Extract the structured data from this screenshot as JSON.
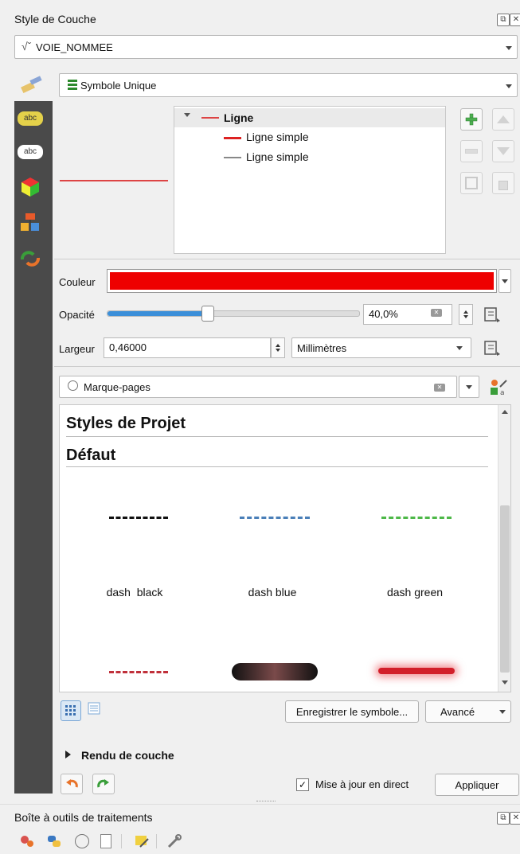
{
  "panel": {
    "title": "Style de Couche",
    "layer_name": "VOIE_NOMMEE",
    "renderer": "Symbole Unique"
  },
  "symbol_tree": {
    "root": "Ligne",
    "layers": [
      "Ligne simple",
      "Ligne simple"
    ]
  },
  "properties": {
    "color_label": "Couleur",
    "color_value": "#ee0000",
    "opacity_label": "Opacité",
    "opacity_value": "40,0%",
    "opacity_fraction": 0.4,
    "width_label": "Largeur",
    "width_value": "0,46000",
    "unit_value": "Millimètres"
  },
  "library": {
    "search_placeholder": "Marque-pages",
    "groups": [
      "Styles de Projet",
      "Défaut"
    ],
    "symbols": [
      {
        "label": "dash  black",
        "color": "#111111"
      },
      {
        "label": "dash blue",
        "color": "#4a7fb8"
      },
      {
        "label": "dash green",
        "color": "#4db848"
      }
    ]
  },
  "buttons": {
    "save_symbol": "Enregistrer le symbole...",
    "advanced": "Avancé",
    "live_update": "Mise à jour en direct",
    "apply": "Appliquer"
  },
  "render_section": "Rendu de couche",
  "toolbox": {
    "title": "Boîte à outils de traitements"
  }
}
